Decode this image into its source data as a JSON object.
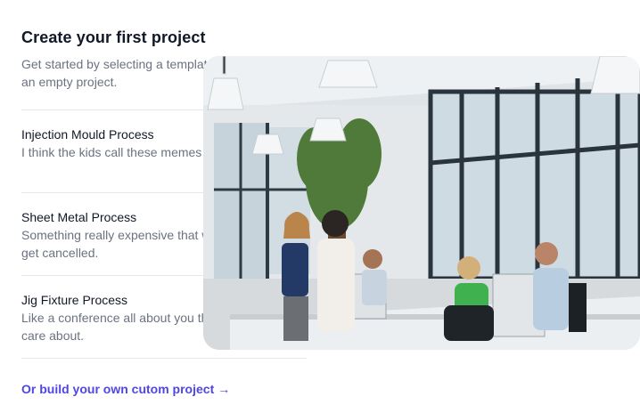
{
  "onboarding": {
    "title": "Create your first project",
    "subtitle": "Get started by selecting a template or start from an empty project.",
    "templates": [
      {
        "title": "Injection Mould Process",
        "description": "I think the kids call these memes these days."
      },
      {
        "title": "Sheet Metal Process",
        "description": "Something really expensive that will ultimately get cancelled."
      },
      {
        "title": "Jig Fixture Process",
        "description": "Like a conference all about you that no one will care about."
      }
    ],
    "cta_label": "Or build your own cutom project",
    "cta_arrow": "→"
  },
  "colors": {
    "accent": "#4f46e5",
    "heading": "#111827",
    "muted": "#6b7280",
    "divider": "#e5e7eb"
  },
  "image": {
    "subject": "office meeting photo"
  }
}
